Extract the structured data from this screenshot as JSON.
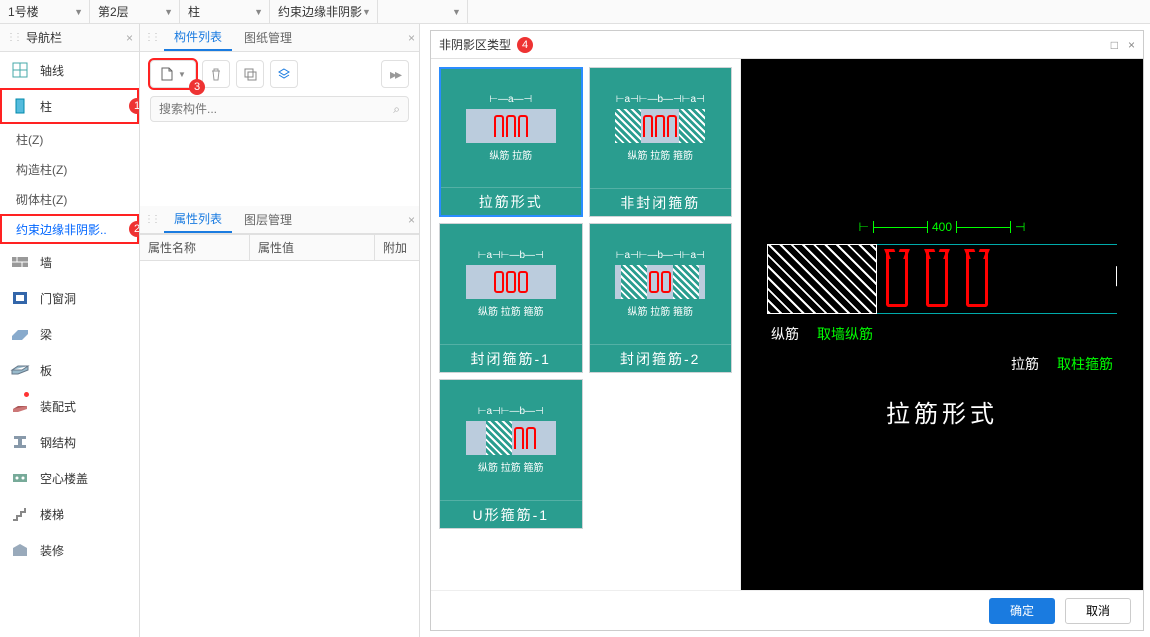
{
  "breadcrumb": [
    "1号楼",
    "第2层",
    "柱",
    "约束边缘非阴影",
    ""
  ],
  "nav": {
    "title": "导航栏",
    "items": [
      {
        "label": "轴线",
        "icon": "grid"
      },
      {
        "label": "柱",
        "icon": "column",
        "hl": true,
        "badge": "1",
        "children": [
          {
            "label": "柱(Z)"
          },
          {
            "label": "构造柱(Z)"
          },
          {
            "label": "砌体柱(Z)"
          },
          {
            "label": "约束边缘非阴影..",
            "sel": true,
            "hl": true,
            "badge": "2"
          }
        ]
      },
      {
        "label": "墙",
        "icon": "wall"
      },
      {
        "label": "门窗洞",
        "icon": "opening"
      },
      {
        "label": "梁",
        "icon": "beam"
      },
      {
        "label": "板",
        "icon": "slab"
      },
      {
        "label": "装配式",
        "icon": "precast",
        "dot": true
      },
      {
        "label": "钢结构",
        "icon": "steel"
      },
      {
        "label": "空心楼盖",
        "icon": "hollow"
      },
      {
        "label": "楼梯",
        "icon": "stair"
      },
      {
        "label": "装修",
        "icon": "finish"
      }
    ]
  },
  "mid": {
    "tabs1": [
      "构件列表",
      "图纸管理"
    ],
    "tabs2": [
      "属性列表",
      "图层管理"
    ],
    "new_badge": "3",
    "search_placeholder": "搜索构件...",
    "prop_cols": [
      "属性名称",
      "属性值",
      "附加"
    ]
  },
  "modal": {
    "title": "非阴影区类型",
    "title_badge": "4",
    "types": [
      {
        "title": "拉筋形式",
        "dims": "⊢—a—⊣",
        "lbls": "纵筋   拉筋",
        "stirs": [
          "u",
          "u",
          "u"
        ],
        "sel": true
      },
      {
        "title": "非封闭箍筋",
        "dims": "⊢a⊣⊢—b—⊣⊢a⊣",
        "lbls": "纵筋  拉筋  箍筋",
        "stirs": [
          "h",
          "u",
          "u",
          "u",
          "h"
        ]
      },
      {
        "title": "封闭箍筋-1",
        "dims": "⊢a⊣⊢—b—⊣",
        "lbls": "纵筋  拉筋  箍筋",
        "stirs": [
          "f",
          "f",
          "f"
        ]
      },
      {
        "title": "封闭箍筋-2",
        "dims": "⊢a⊣⊢—b—⊣⊢a⊣",
        "lbls": "纵筋  拉筋  箍筋",
        "stirs": [
          "h",
          "f",
          "f",
          "h"
        ]
      },
      {
        "title": "U形箍筋-1",
        "dims": "⊢a⊣⊢—b—⊣",
        "lbls": "纵筋  拉筋  箍筋",
        "stirs": [
          "h",
          "u",
          "u"
        ]
      }
    ],
    "preview": {
      "dim": "400",
      "line1_a": "纵筋",
      "line1_b": "取墙纵筋",
      "line2_a": "拉筋",
      "line2_b": "取柱箍筋",
      "big": "拉筋形式"
    },
    "ok": "确定",
    "cancel": "取消"
  }
}
